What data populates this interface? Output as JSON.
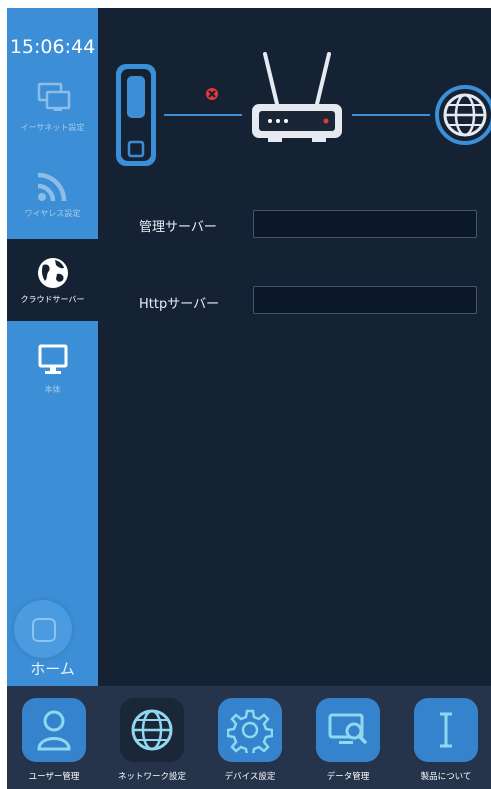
{
  "status": {
    "time": "15:06:44"
  },
  "sidebar": {
    "items": [
      {
        "label": "イーサネット設定",
        "icon": "ethernet-monitor-icon",
        "active": false
      },
      {
        "label": "ワイヤレス設定",
        "icon": "wifi-icon",
        "active": false
      },
      {
        "label": "クラウドサーバー",
        "icon": "globe-icon",
        "active": true
      },
      {
        "label": "本体",
        "icon": "monitor-icon",
        "active": false
      }
    ],
    "home_label": "ホーム"
  },
  "diagram": {
    "status_icon": "error-x-icon",
    "nodes": [
      "device-icon",
      "router-icon",
      "internet-globe-icon"
    ],
    "colors": {
      "accent": "#3c8fd6",
      "error": "#e53935"
    }
  },
  "form": {
    "management_server": {
      "label": "管理サーバー",
      "value": ""
    },
    "http_server": {
      "label": "Httpサーバー",
      "value": ""
    }
  },
  "bottom_nav": {
    "items": [
      {
        "label": "ユーザー管理",
        "icon": "user-icon",
        "active": false
      },
      {
        "label": "ネットワーク設定",
        "icon": "network-globe-icon",
        "active": true
      },
      {
        "label": "デバイス設定",
        "icon": "gear-icon",
        "active": false
      },
      {
        "label": "データ管理",
        "icon": "data-search-icon",
        "active": false
      },
      {
        "label": "製品について",
        "icon": "info-icon",
        "active": false
      }
    ]
  }
}
